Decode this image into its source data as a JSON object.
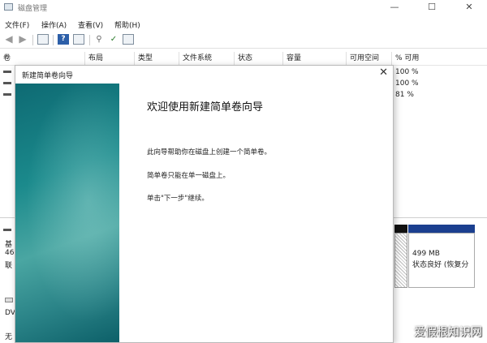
{
  "window": {
    "title": "磁盘管理",
    "minimize": "—",
    "maximize": "☐",
    "close": "✕"
  },
  "menu": [
    "文件(F)",
    "操作(A)",
    "查看(V)",
    "帮助(H)"
  ],
  "toolbar_icons": [
    "back-icon",
    "forward-icon",
    "console-tree-icon",
    "help-icon",
    "properties-icon",
    "connect-icon",
    "check-icon",
    "settings-icon"
  ],
  "columns": [
    "卷",
    "布局",
    "类型",
    "文件系统",
    "状态",
    "容量",
    "可用空间",
    "% 可用"
  ],
  "rows": [
    {
      "pct": "100 %"
    },
    {
      "pct": "100 %"
    },
    {
      "pct": "81 %"
    }
  ],
  "graphic": {
    "disk_labels": [
      "基",
      "46",
      "联"
    ],
    "dvd_label": "DV",
    "no_media": "无",
    "partition_size": "499 MB",
    "partition_status": "状态良好 (恢复分"
  },
  "wizard": {
    "title": "新建简单卷向导",
    "close": "✕",
    "heading": "欢迎使用新建简单卷向导",
    "line1": "此向导帮助你在磁盘上创建一个简单卷。",
    "line2": "简单卷只能在单一磁盘上。",
    "line3": "单击\"下一步\"继续。"
  },
  "watermark": "爱假根知识网"
}
